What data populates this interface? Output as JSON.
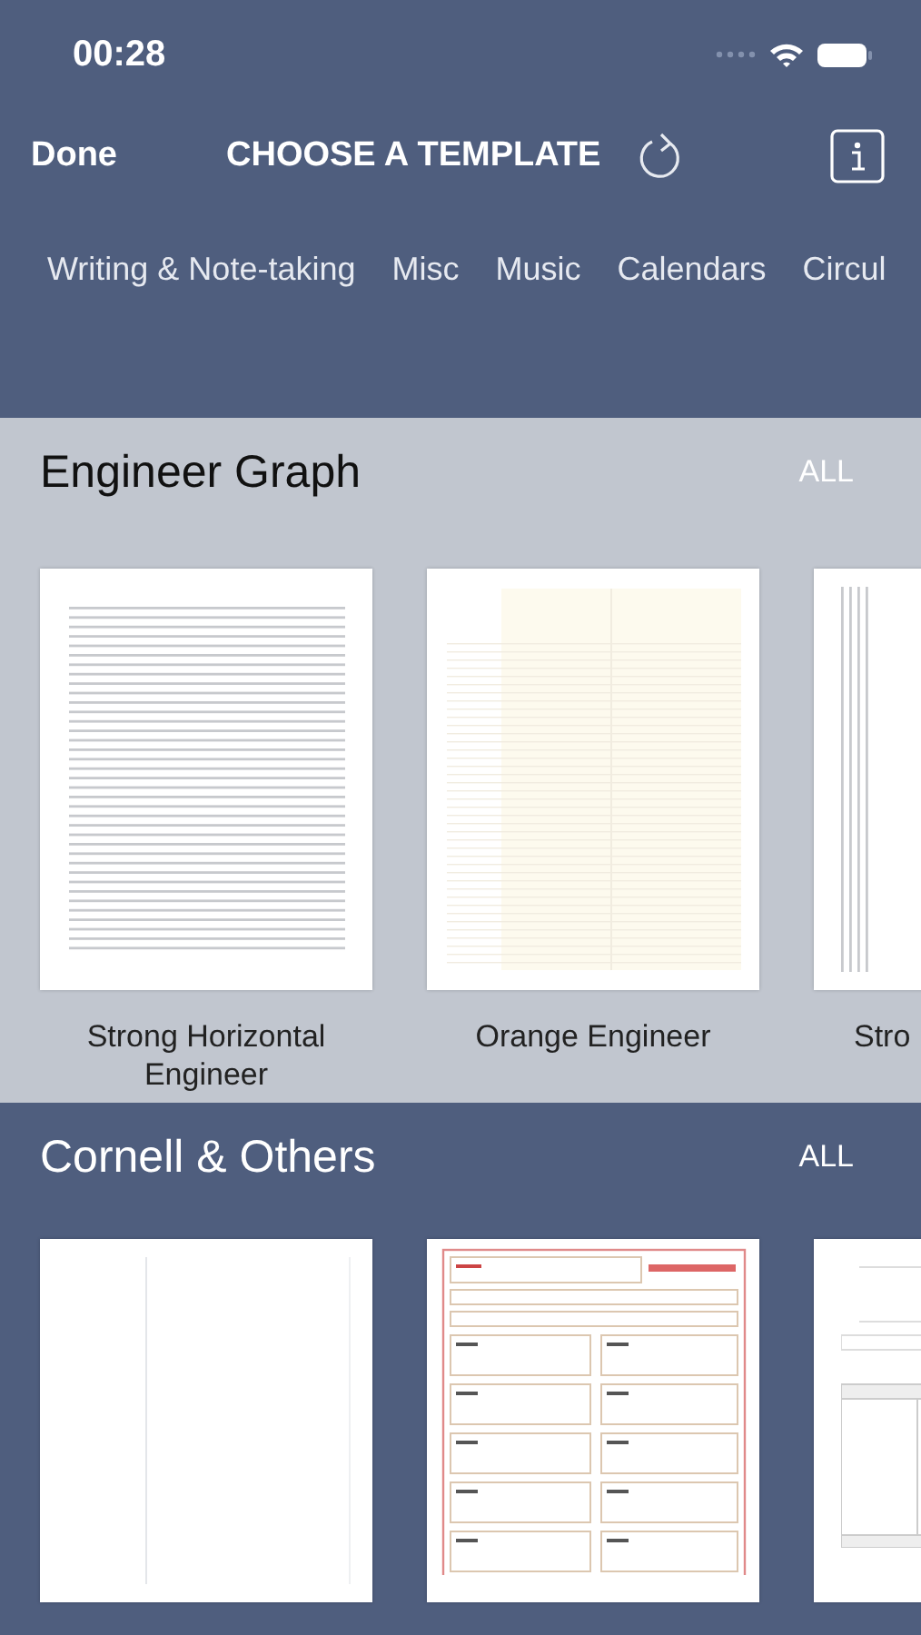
{
  "status_bar": {
    "time": "00:28"
  },
  "nav": {
    "done": "Done",
    "title": "CHOOSE A TEMPLATE"
  },
  "tabs": [
    {
      "label": "Writing & Note-taking"
    },
    {
      "label": "Misc"
    },
    {
      "label": "Music"
    },
    {
      "label": "Calendars"
    },
    {
      "label": "Circul"
    }
  ],
  "sections": [
    {
      "title": "Engineer Graph",
      "all": "ALL",
      "kind": "light",
      "templates": [
        {
          "name": "Strong Horizontal Engineer",
          "kind": "horizontal-lines"
        },
        {
          "name": "Orange Engineer",
          "kind": "orange-grid"
        },
        {
          "name": "Stro",
          "kind": "vertical-lines"
        }
      ]
    },
    {
      "title": "Cornell & Others",
      "all": "ALL",
      "kind": "dark",
      "templates": [
        {
          "kind": "margin"
        },
        {
          "kind": "cornell"
        },
        {
          "kind": "form"
        }
      ]
    }
  ]
}
